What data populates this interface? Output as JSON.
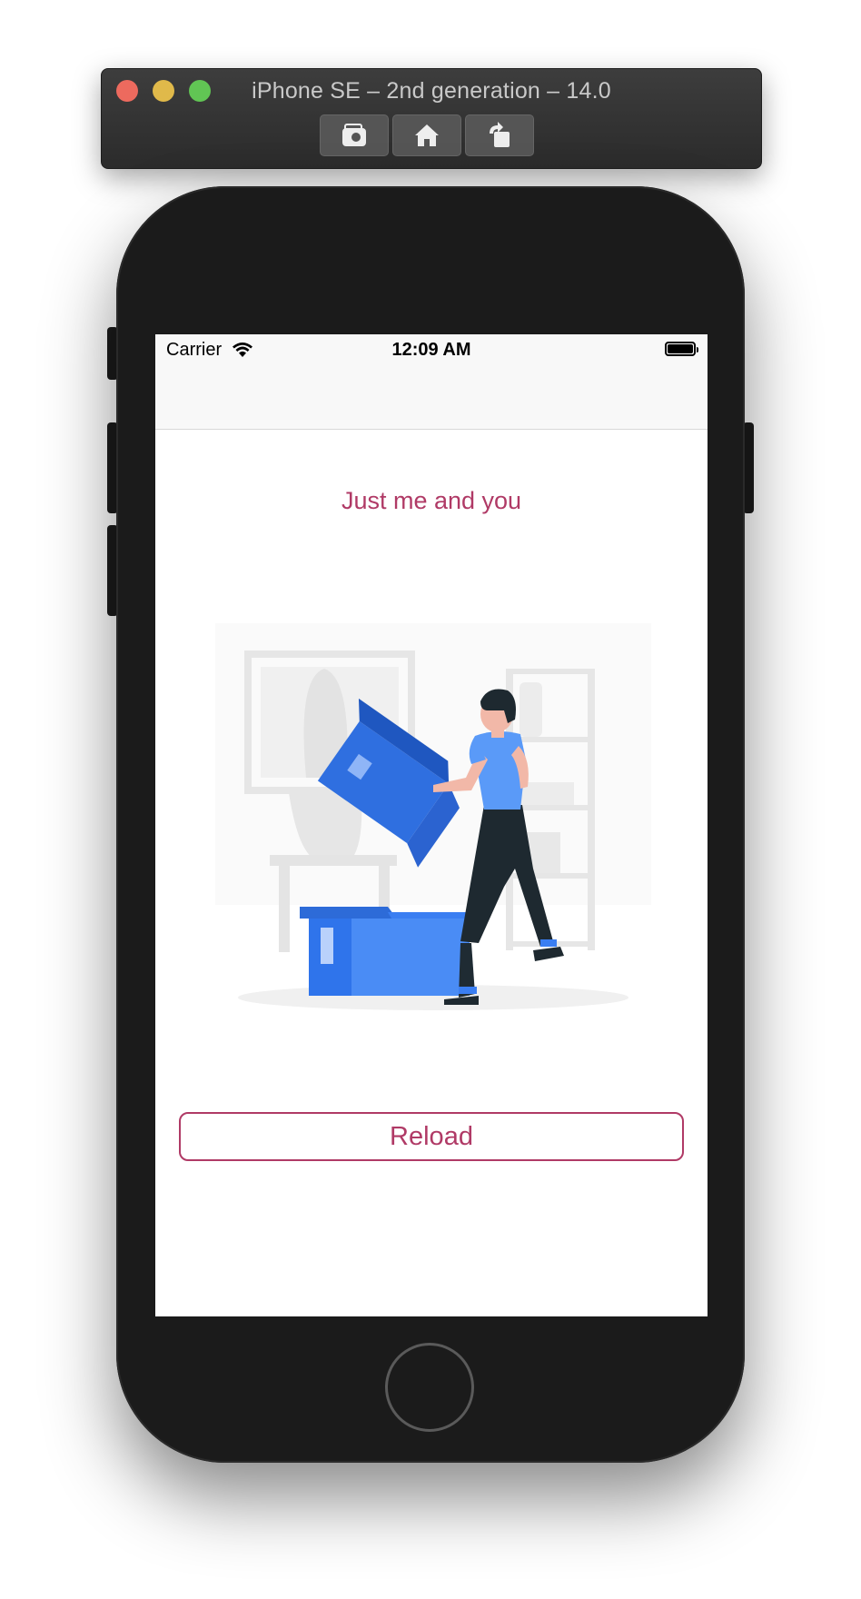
{
  "window": {
    "title": "iPhone SE – 2nd generation – 14.0",
    "toolbar_buttons": [
      {
        "icon": "camera-icon"
      },
      {
        "icon": "home-icon"
      },
      {
        "icon": "rotate-icon"
      }
    ]
  },
  "status_bar": {
    "carrier": "Carrier",
    "time": "12:09 AM"
  },
  "content": {
    "headline": "Just me and you",
    "reload_label": "Reload"
  },
  "colors": {
    "accent": "#b03a66",
    "illustration_blue": "#3a7ef2"
  }
}
